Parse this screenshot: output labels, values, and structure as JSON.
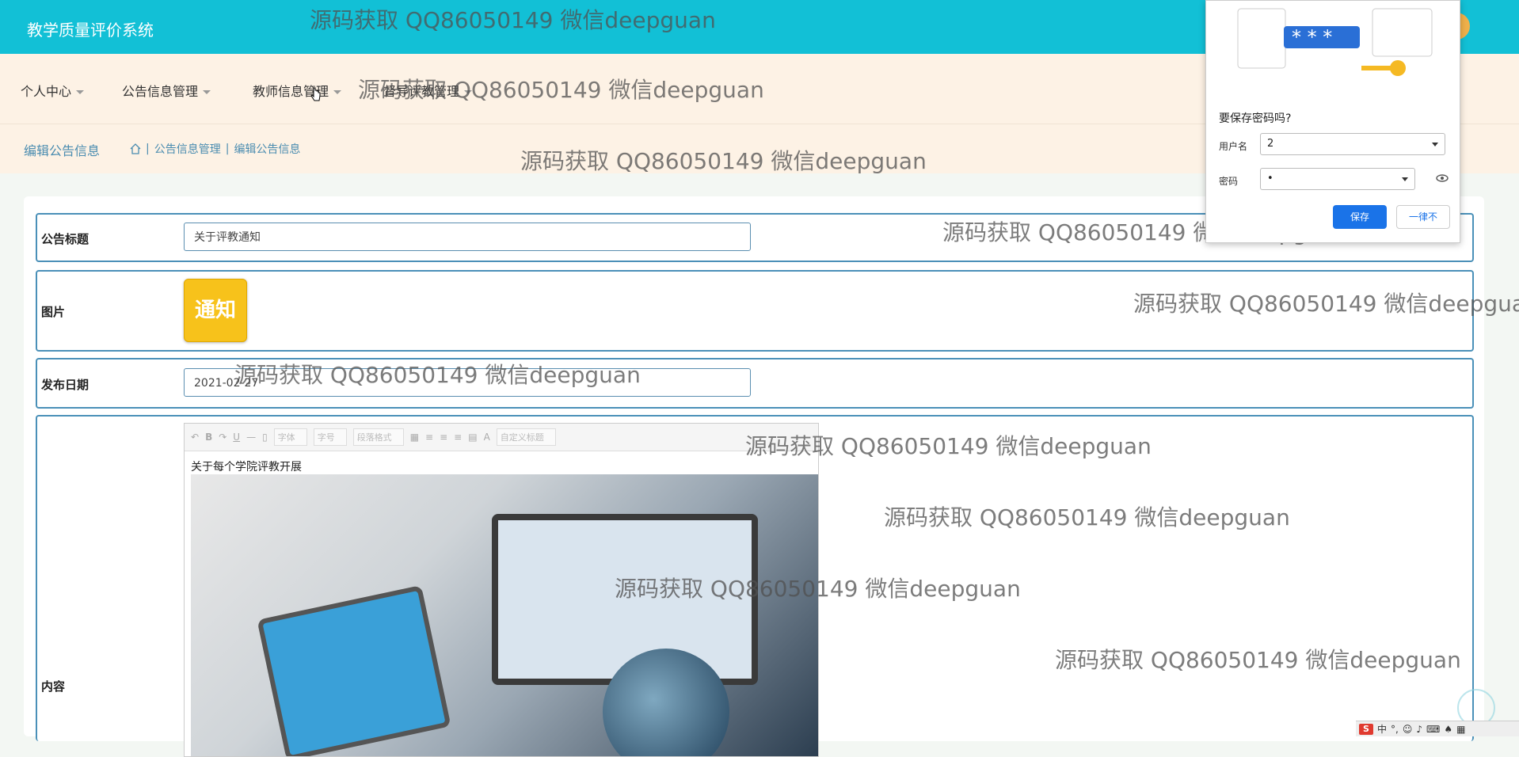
{
  "app": {
    "title": "教学质量评价系统"
  },
  "nav": {
    "items": [
      {
        "label": "个人中心"
      },
      {
        "label": "公告信息管理"
      },
      {
        "label": "教师信息管理"
      },
      {
        "label": "督导评教管理"
      }
    ]
  },
  "breadcrumb": {
    "title": "编辑公告信息",
    "items": [
      "公告信息管理",
      "编辑公告信息"
    ],
    "separator": "|"
  },
  "form": {
    "title": {
      "label": "公告标题",
      "value": "关于评教通知"
    },
    "image": {
      "label": "图片",
      "image_text": "通知"
    },
    "date": {
      "label": "发布日期",
      "value": "2021-02-27"
    },
    "content": {
      "label": "内容",
      "toolbar": {
        "font": "字体",
        "size": "字号",
        "paragraph": "段落格式",
        "custom": "自定义标题",
        "color_letter": "A"
      },
      "text": "关于每个学院评教开展"
    }
  },
  "password_popup": {
    "question": "要保存密码吗?",
    "username_label": "用户名",
    "username_value": "2",
    "password_label": "密码",
    "password_value": "•",
    "save_label": "保存",
    "never_label": "一律不"
  },
  "watermark": "源码获取 QQ86050149 微信deepguan",
  "ime": {
    "mode": "中"
  },
  "colors": {
    "topbar": "#12c0d6",
    "nav_bg": "#fdf2e5",
    "row_border": "#4a90b8",
    "accent": "#1a73e8"
  }
}
